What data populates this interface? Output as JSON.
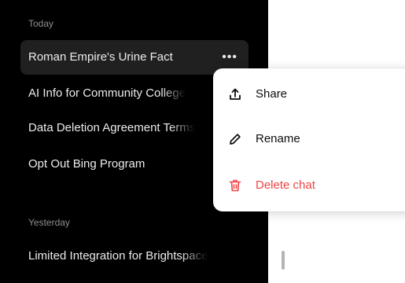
{
  "sidebar": {
    "sections": [
      {
        "label": "Today",
        "items": [
          {
            "title": "Roman Empire's Urine Fact",
            "active": true
          },
          {
            "title": "AI Info for Community College"
          },
          {
            "title": "Data Deletion Agreement Terms"
          },
          {
            "title": "Opt Out Bing Program"
          }
        ]
      },
      {
        "label": "Yesterday",
        "items": [
          {
            "title": "Limited Integration for Brightspace"
          }
        ]
      }
    ],
    "more_icon": "ellipsis-icon"
  },
  "context_menu": {
    "items": [
      {
        "label": "Share",
        "icon": "share-icon"
      },
      {
        "label": "Rename",
        "icon": "pencil-icon"
      },
      {
        "label": "Delete chat",
        "icon": "trash-icon",
        "danger": true
      }
    ]
  },
  "colors": {
    "sidebar_bg": "#000000",
    "active_item_bg": "#202020",
    "section_label": "#8e8e8e",
    "danger": "#ef4444"
  }
}
